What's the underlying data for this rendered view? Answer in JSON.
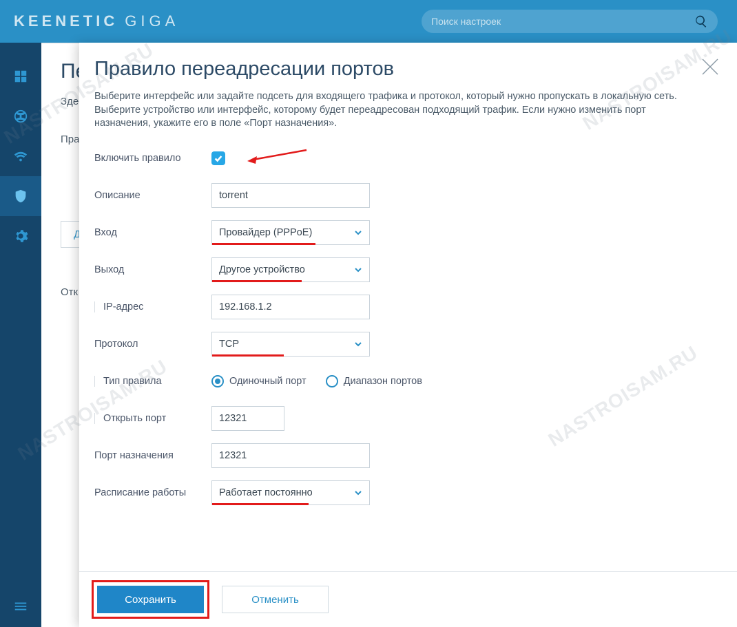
{
  "header": {
    "brand_main": "KEENETIC",
    "brand_sub": "GIGA",
    "search_placeholder": "Поиск настроек"
  },
  "background": {
    "title_fragment": "Пе",
    "line1": "Здес",
    "line2": "Пра",
    "button_fragment": "Д",
    "line3": "Отк"
  },
  "modal": {
    "title": "Правило переадресации портов",
    "description": "Выберите интерфейс или задайте подсеть для входящего трафика и протокол, который нужно пропускать в локальную сеть. Выберите устройство или интерфейс, которому будет переадресован подходящий трафик. Если нужно изменить порт назначения, укажите его в поле «Порт назначения».",
    "labels": {
      "enable_rule": "Включить правило",
      "description_field": "Описание",
      "input_if": "Вход",
      "output_if": "Выход",
      "ip": "IP-адрес",
      "protocol": "Протокол",
      "rule_type": "Тип правила",
      "open_port": "Открыть порт",
      "dst_port": "Порт назначения",
      "schedule": "Расписание работы"
    },
    "values": {
      "enabled": true,
      "description": "torrent",
      "input_if": "Провайдер (PPPoE)",
      "output_if": "Другое устройство",
      "ip": "192.168.1.2",
      "protocol": "TCP",
      "rule_type_single": "Одиночный порт",
      "rule_type_range": "Диапазон портов",
      "open_port": "12321",
      "dst_port": "12321",
      "schedule": "Работает постоянно"
    },
    "buttons": {
      "save": "Сохранить",
      "cancel": "Отменить"
    }
  },
  "watermark": "NASTROISAM.RU"
}
